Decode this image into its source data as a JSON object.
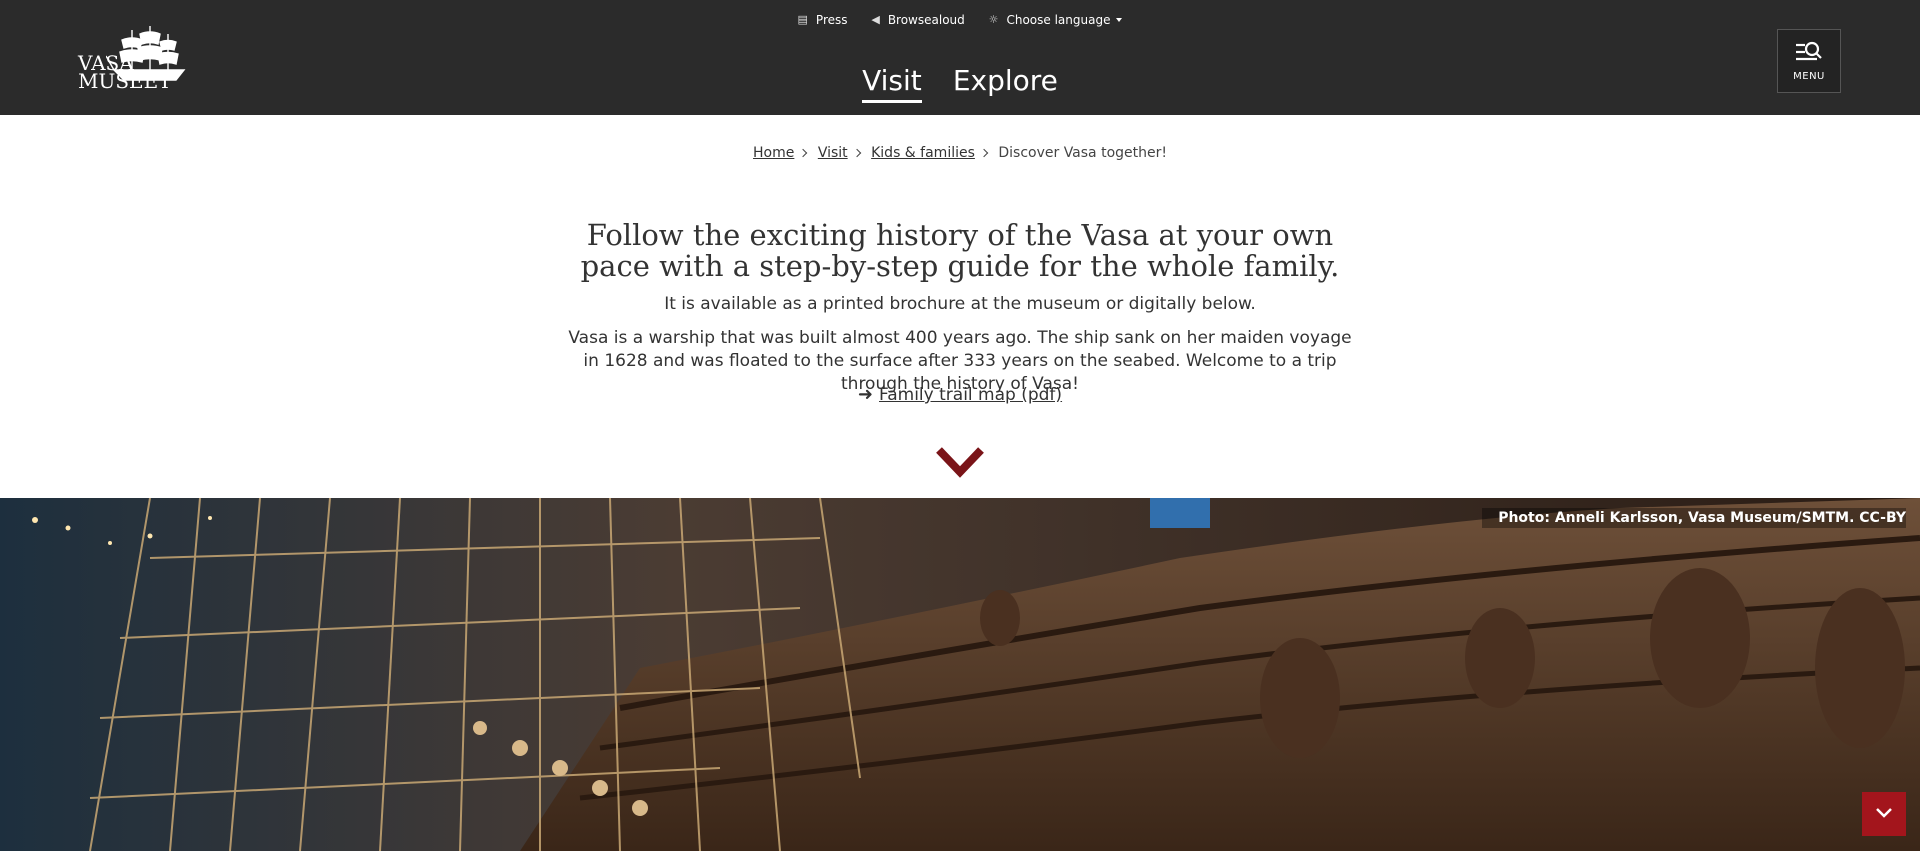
{
  "header": {
    "logo_lines": [
      "VASA",
      "MUSEET"
    ],
    "util_nav": [
      {
        "label": "Press",
        "icon": "press-icon"
      },
      {
        "label": "Browsealoud",
        "icon": "speaker-icon"
      },
      {
        "label": "Choose language",
        "icon": "globe-icon"
      }
    ],
    "main_nav": [
      {
        "label": "Visit",
        "active": true
      },
      {
        "label": "Explore",
        "active": false
      }
    ],
    "menu_label": "MENU"
  },
  "breadcrumb": {
    "items": [
      {
        "label": "Home"
      },
      {
        "label": "Visit"
      },
      {
        "label": "Kids & families"
      }
    ],
    "current": "Discover Vasa together!"
  },
  "content": {
    "title": "Follow the exciting history of the Vasa at your own pace with a step-by-step guide for the whole family.",
    "lead": "It is available as a printed brochure at the museum or digitally below.",
    "body": "Vasa is a warship that was built almost 400 years ago. The ship sank on her maiden voyage in 1628 and was floated to the surface after 333 years on the seabed. Welcome to a trip through the history of Vasa!",
    "pdf_link": "Family trail map (pdf)"
  },
  "hero": {
    "photo_credit": "Photo: Anneli Karlsson, Vasa Museum/SMTM. CC-BY"
  },
  "colors": {
    "header_bg": "#2b2b2b",
    "accent_red": "#a3151c",
    "chevron_red": "#7a1418"
  }
}
